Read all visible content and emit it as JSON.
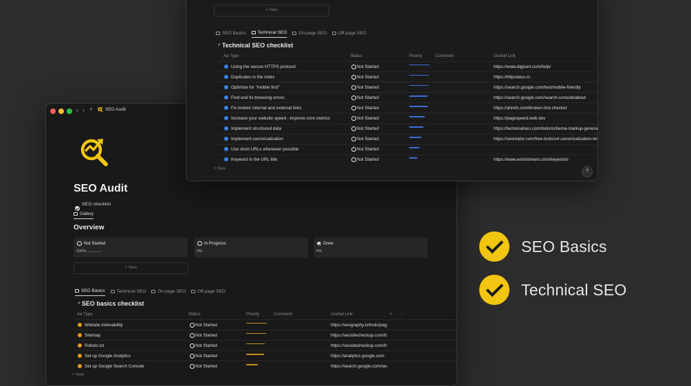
{
  "front": {
    "breadcrumb": "SEO Audit",
    "title": "SEO Audit",
    "subtitle": "SEO checklist",
    "view_tab": "Gallery",
    "overview_heading": "Overview",
    "cards": [
      {
        "label": "Not Started",
        "value": "100%",
        "progress": 1.0
      },
      {
        "label": "In Progress",
        "value": "0%",
        "progress": 0
      },
      {
        "label": "Done",
        "value": "0%",
        "progress": 0
      }
    ],
    "new_label": "+ New",
    "tabs": [
      "SEO Basics",
      "Technical SEO",
      "On-page SEO",
      "Off-page SEO"
    ],
    "list_title": "SEO basics checklist",
    "columns": {
      "type": "Aa Type",
      "status": "Status",
      "priority": "Priority",
      "comment": "Comment",
      "link": "Usefull Link",
      "add": "+",
      "more": "···"
    },
    "rows": [
      {
        "name": "Website indexability",
        "status": "Not Started",
        "priority": 1.0,
        "link": "https://seography.io/tools/page-index-checker"
      },
      {
        "name": "Sitemap",
        "status": "Not Started",
        "priority": 0.95,
        "link": "https://seositecheckup.com/tools/sitemap-test"
      },
      {
        "name": "Robots.txt",
        "status": "Not Started",
        "priority": 0.9,
        "link": "https://seositecheckup.com/tools/robotstxt-test"
      },
      {
        "name": "Set up Google Analytics",
        "status": "Not Started",
        "priority": 0.85,
        "link": "https://analytics.google.com"
      },
      {
        "name": "Set up Google Search Console",
        "status": "Not Started",
        "priority": 0.55,
        "link": "https://search.google.com/search-console"
      }
    ],
    "new_row_label": "+ New"
  },
  "back": {
    "new_label": "+ New",
    "tabs": [
      "SEO Basics",
      "Technical SEO",
      "On-page SEO",
      "Off-page SEO"
    ],
    "list_title": "Technical SEO checklist",
    "columns": {
      "type": "Aa Type",
      "status": "Status",
      "priority": "Priority",
      "comment": "Comment",
      "link": "Usefull Link"
    },
    "rows": [
      {
        "name": "Using the secure HTTPS protocol",
        "status": "Not Started",
        "priority": 1.0,
        "link": "https://www.digicert.com/help/"
      },
      {
        "name": "Duplicates in the index",
        "status": "Not Started",
        "priority": 0.95,
        "link": "https://httpstatus.io"
      },
      {
        "name": "Optimize for \"mobile first\"",
        "status": "Not Started",
        "priority": 0.95,
        "link": "https://search.google.com/test/mobile-friendly"
      },
      {
        "name": "Find and fix browsing errors",
        "status": "Not Started",
        "priority": 0.9,
        "link": "https://search.google.com/search-console/about"
      },
      {
        "name": "Fix broken internal and external links",
        "status": "Not Started",
        "priority": 0.9,
        "link": "https://ahrefs.com/broken-link-checker"
      },
      {
        "name": "Increase your website speed - improve core metrics",
        "status": "Not Started",
        "priority": 0.75,
        "link": "https://pagespeed.web.dev"
      },
      {
        "name": "Implement structured data",
        "status": "Not Started",
        "priority": 0.7,
        "link": "https://technicalseo.com/tools/schema-markup-generator/"
      },
      {
        "name": "Implement canonicalization",
        "status": "Not Started",
        "priority": 0.6,
        "link": "https://seomator.com/free-tools/url-canonicalization-test"
      },
      {
        "name": "Use short URLs whenever possible",
        "status": "Not Started",
        "priority": 0.5,
        "link": ""
      },
      {
        "name": "Keyword in the URL title",
        "status": "Not Started",
        "priority": 0.4,
        "link": "https://www.wordstream.com/keywords"
      }
    ],
    "new_row_label": "+ New",
    "help_label": "?"
  },
  "features": [
    {
      "label": "SEO Basics"
    },
    {
      "label": "Technical SEO"
    }
  ],
  "colors": {
    "accent": "#f2c510",
    "bullet_orange": "#e89a1c",
    "bullet_blue": "#3b82e4",
    "priority_orange": "#c9901c",
    "priority_blue": "#3b6fd6"
  }
}
